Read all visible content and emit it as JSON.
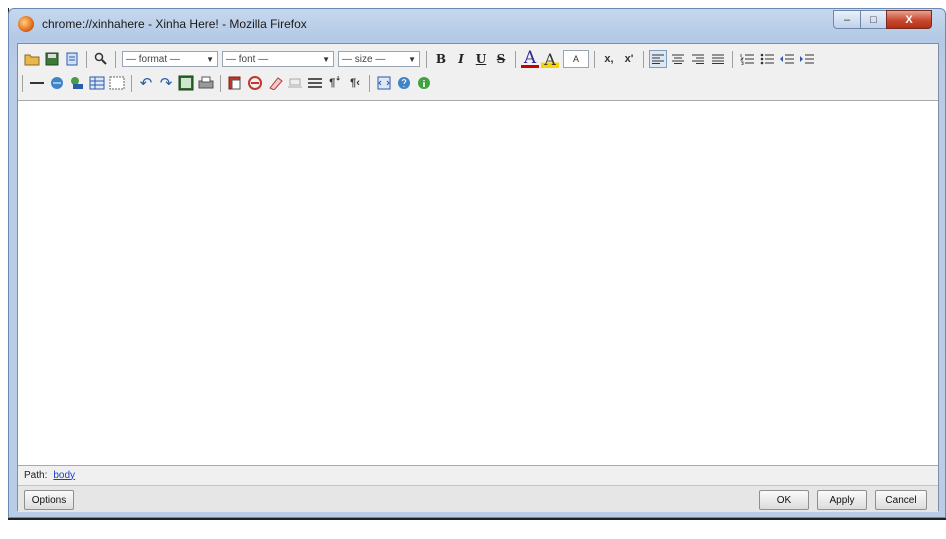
{
  "window": {
    "title": "chrome://xinhahere - Xinha Here! - Mozilla Firefox",
    "controls": {
      "minimize": "–",
      "maximize": "□",
      "close": "X"
    }
  },
  "toolbar": {
    "format_select": "— format —",
    "font_select": "— font —",
    "size_select": "— size —",
    "bold": "B",
    "italic": "I",
    "underline": "U",
    "strike": "S",
    "fontcolor_letter": "A",
    "hilite_letter": "A",
    "textindicator": "A",
    "subscript": "x,",
    "superscript": "x'"
  },
  "statusbar": {
    "path_label": "Path:",
    "path_link": "body"
  },
  "buttons": {
    "options": "Options",
    "ok": "OK",
    "apply": "Apply",
    "cancel": "Cancel"
  },
  "colors": {
    "titlebar": "#b8cce6",
    "close_button": "#c9482f",
    "link": "#1a3ccf"
  }
}
